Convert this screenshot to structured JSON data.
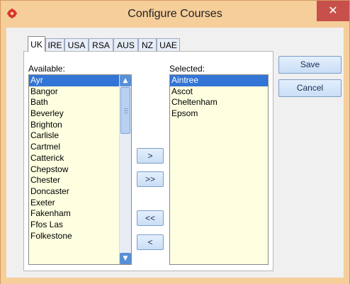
{
  "window": {
    "title": "Configure Courses",
    "close_symbol": "✕"
  },
  "tabs": [
    {
      "label": "UK",
      "active": true
    },
    {
      "label": "IRE"
    },
    {
      "label": "USA"
    },
    {
      "label": "RSA"
    },
    {
      "label": "AUS"
    },
    {
      "label": "NZ"
    },
    {
      "label": "UAE"
    }
  ],
  "available": {
    "label": "Available:",
    "items": [
      "Ayr",
      "Bangor",
      "Bath",
      "Beverley",
      "Brighton",
      "Carlisle",
      "Cartmel",
      "Catterick",
      "Chepstow",
      "Chester",
      "Doncaster",
      "Exeter",
      "Fakenham",
      "Ffos Las",
      "Folkestone"
    ],
    "selected_index": 0
  },
  "selected": {
    "label": "Selected:",
    "items": [
      "Aintree",
      "Ascot",
      "Cheltenham",
      "Epsom"
    ],
    "selected_index": 0
  },
  "move_buttons": {
    "add": ">",
    "add_all": ">>",
    "remove_all": "<<",
    "remove": "<"
  },
  "actions": {
    "save": "Save",
    "cancel": "Cancel"
  },
  "colors": {
    "frame": "#f5ce9a",
    "selection": "#3375d6",
    "list_bg": "#fefee0",
    "close": "#c7504b"
  }
}
